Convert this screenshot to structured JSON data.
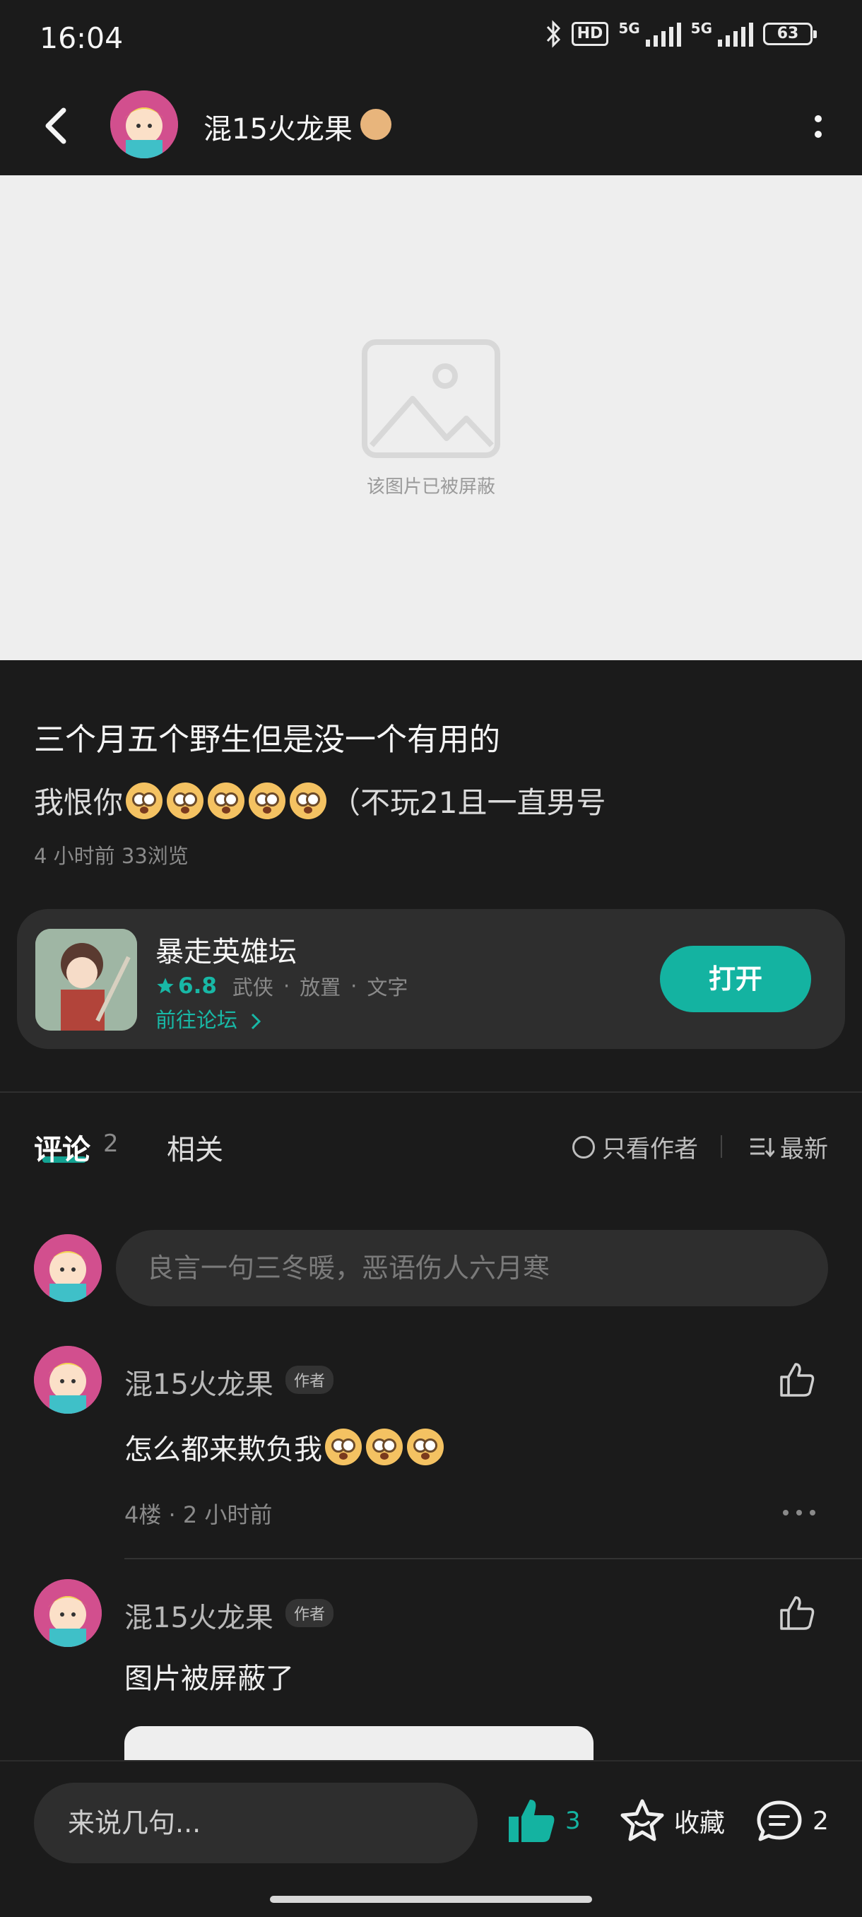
{
  "status_bar": {
    "time": "16:04",
    "hd": "HD",
    "net1": "5G",
    "net2": "5G",
    "battery": "63"
  },
  "header": {
    "author_name": "混15火龙果"
  },
  "blocked_image": {
    "text": "该图片已被屏蔽"
  },
  "post": {
    "title": "三个月五个野生但是没一个有用的",
    "content_prefix": "我恨你",
    "content_suffix": "（不玩21且一直男号",
    "emoji_count": 5,
    "meta": "4 小时前  33浏览"
  },
  "forum_card": {
    "name": "暴走英雄坛",
    "rating": "6.8",
    "tags": [
      "武侠",
      "放置",
      "文字"
    ],
    "forum_link": "前往论坛",
    "open_label": "打开"
  },
  "tabs": {
    "comments_label": "评论",
    "comments_count": "2",
    "related_label": "相关",
    "author_only_label": "只看作者",
    "sort_label": "最新"
  },
  "comment_input": {
    "placeholder": "良言一句三冬暖，恶语伤人六月寒"
  },
  "comments": [
    {
      "name": "混15火龙果",
      "tag": "作者",
      "text": "怎么都来欺负我",
      "emoji_count": 3,
      "meta": "4楼 · 2 小时前"
    },
    {
      "name": "混15火龙果",
      "tag": "作者",
      "text": "图片被屏蔽了"
    }
  ],
  "bottom_bar": {
    "reply_placeholder": "来说几句...",
    "like_count": "3",
    "favorite_label": "收藏",
    "comment_count": "2"
  },
  "colors": {
    "accent": "#14b3a1",
    "background": "#1b1b1b",
    "card": "#2e2e2e"
  },
  "icons": [
    "bluetooth-icon",
    "signal-icon",
    "battery-icon",
    "back-icon",
    "more-icon",
    "blocked-image-icon",
    "star-icon",
    "chevron-right-icon",
    "sort-icon",
    "thumbs-up-icon",
    "ellipsis-icon",
    "favorite-star-icon",
    "comment-bubble-icon"
  ]
}
